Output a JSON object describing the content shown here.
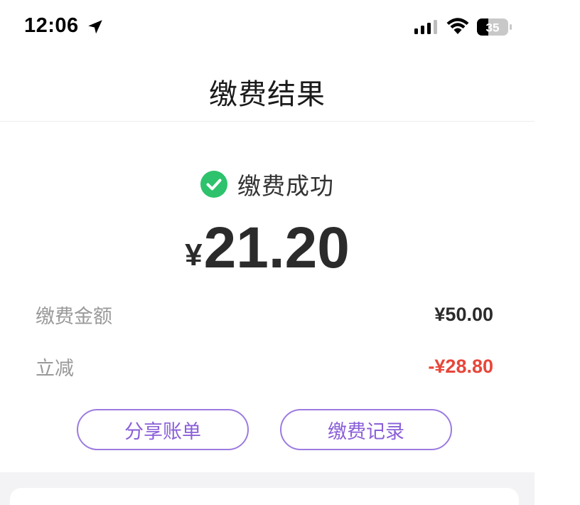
{
  "status_bar": {
    "time": "12:06",
    "battery_level": "35",
    "icons": [
      "location-arrow-icon",
      "signal-icon",
      "wifi-icon",
      "battery-icon"
    ]
  },
  "nav": {
    "title": "缴费结果"
  },
  "result": {
    "status_text": "缴费成功",
    "currency_symbol": "¥",
    "amount": "21.20",
    "status_icon": "check-circle-icon"
  },
  "details": [
    {
      "label": "缴费金额",
      "value": "¥50.00"
    },
    {
      "label": "立减",
      "value": "-¥28.80"
    }
  ],
  "actions": {
    "share_label": "分享账单",
    "records_label": "缴费记录"
  },
  "colors": {
    "success_green": "#2dc26b",
    "accent_purple": "#8a5fd8",
    "discount_red": "#e8463a",
    "label_gray": "#999999"
  }
}
